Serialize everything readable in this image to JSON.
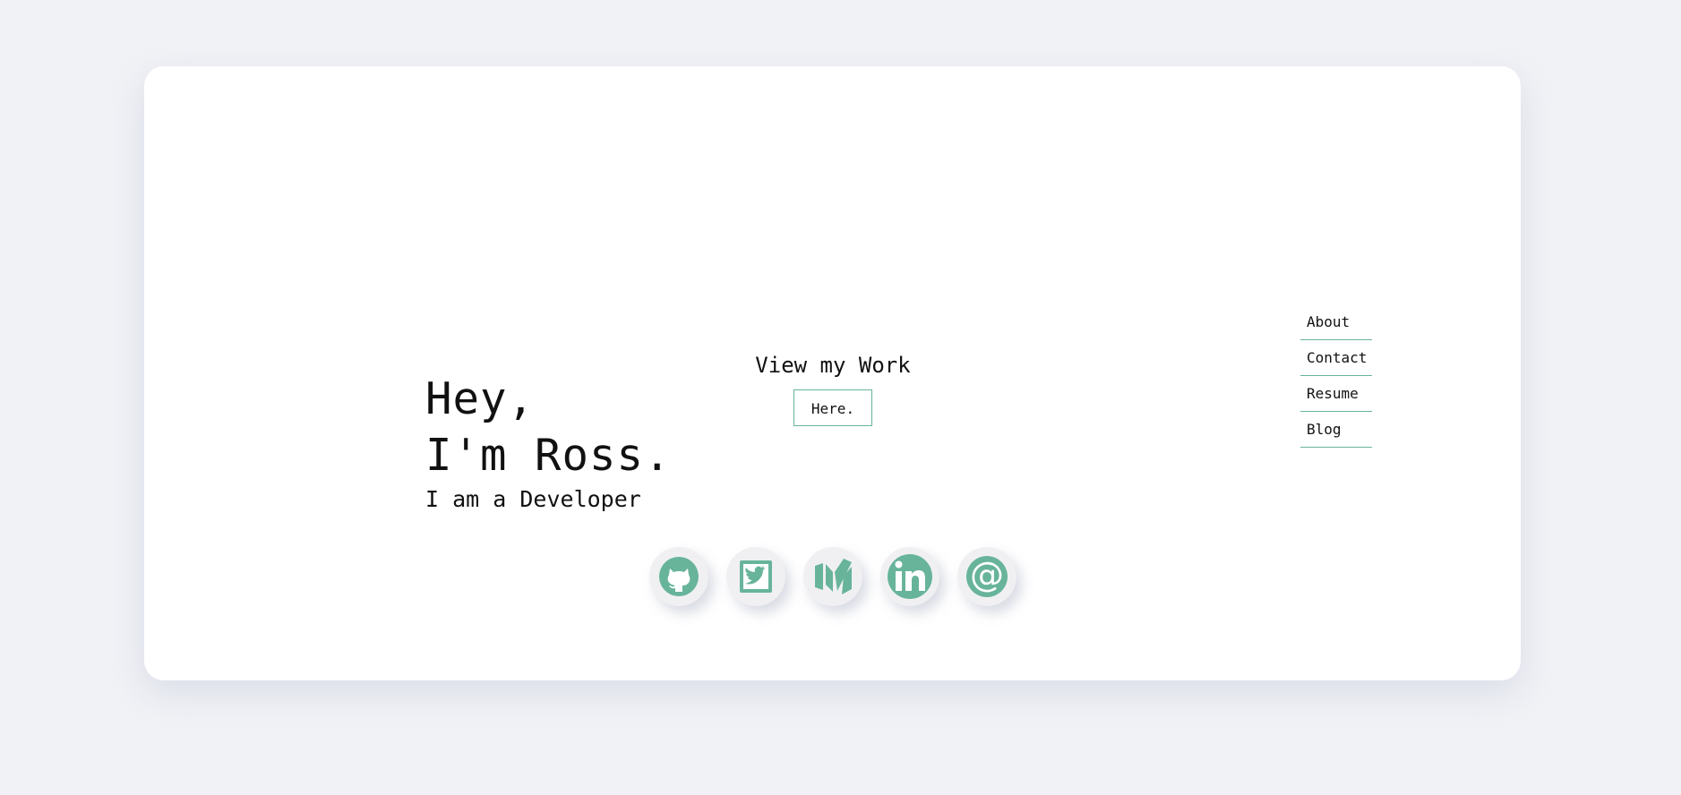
{
  "intro": {
    "greeting": "Hey,",
    "name_line": "I'm Ross.",
    "role_line": "I am a Developer"
  },
  "work": {
    "title": "View my Work",
    "button_label": "Here."
  },
  "nav": {
    "items": [
      {
        "label": "About"
      },
      {
        "label": "Contact"
      },
      {
        "label": "Resume"
      },
      {
        "label": "Blog"
      }
    ]
  },
  "socials": {
    "items": [
      {
        "icon": "github-icon"
      },
      {
        "icon": "twitter-icon"
      },
      {
        "icon": "medium-icon"
      },
      {
        "icon": "linkedin-icon"
      },
      {
        "icon": "email-at-icon"
      }
    ]
  },
  "colors": {
    "page_background": "#f1f2f6",
    "card_background": "#ffffff",
    "accent": "#68b49b",
    "icon_circle": "#f0f0f2",
    "text": "#111111"
  }
}
